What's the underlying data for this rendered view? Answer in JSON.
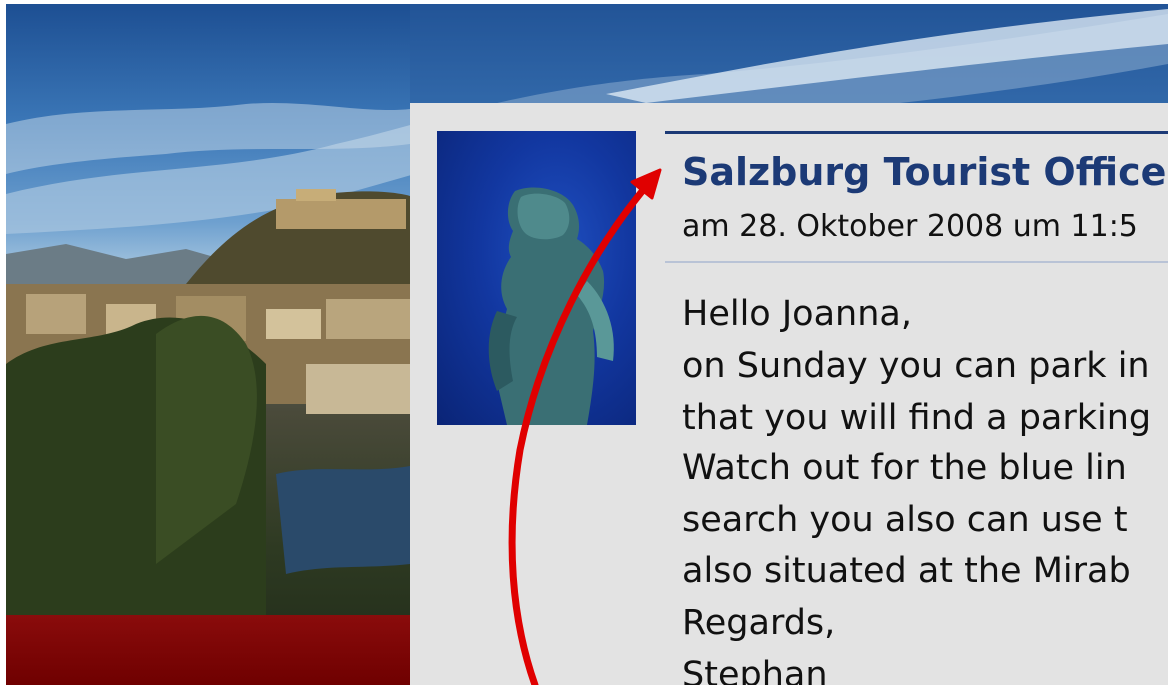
{
  "comment": {
    "author": "Salzburg Tourist Office",
    "timestamp": "am 28. Oktober 2008 um 11:5",
    "lines": [
      "Hello Joanna,",
      "on Sunday you can park in",
      "that you will find a parking",
      "Watch out for the blue lin",
      "search you also can use t",
      "also situated at the Mirab",
      "Regards,",
      "Stephan"
    ]
  },
  "colors": {
    "author_text": "#1c3a76",
    "panel_background": "#e3e3e3",
    "annotation_arrow": "#e00000",
    "banner": "#7a0000"
  },
  "icons": {
    "avatar": "mozart-statue-avatar",
    "annotation": "red-curved-arrow"
  }
}
